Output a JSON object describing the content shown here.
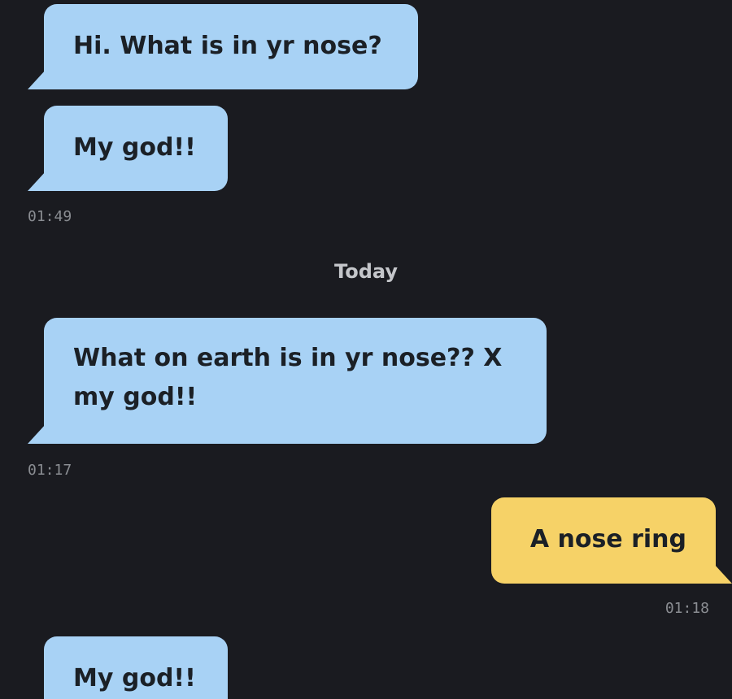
{
  "chat": {
    "messages": [
      {
        "text": "Hi. What is in yr nose?",
        "direction": "incoming"
      },
      {
        "text": "My god!!",
        "direction": "incoming"
      },
      {
        "text": "What on earth is in yr nose?? X my god!!",
        "direction": "incoming"
      },
      {
        "text": "A nose ring",
        "direction": "outgoing"
      },
      {
        "text": "My god!!",
        "direction": "incoming"
      }
    ],
    "timestamps": [
      "01:49",
      "01:17",
      "01:18"
    ],
    "date_divider": "Today"
  },
  "colors": {
    "background": "#1a1b20",
    "incoming_bubble": "#a8d2f5",
    "outgoing_bubble": "#f6d267",
    "timestamp_text": "#8a8d92"
  }
}
